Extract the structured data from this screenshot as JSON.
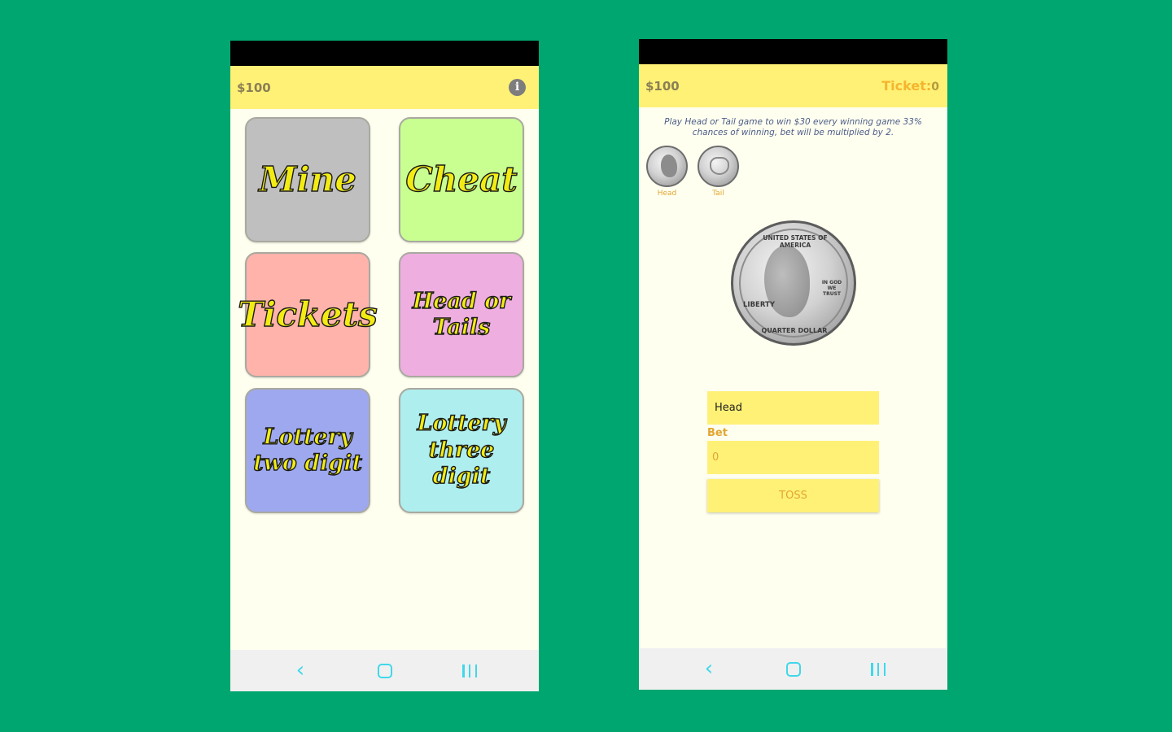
{
  "colors": {
    "background": "#00a66f",
    "appbar": "#fff176",
    "screen": "#fffff0",
    "accent": "#e1a631",
    "nav_icon": "#3fd8ea"
  },
  "menu_screen": {
    "balance": "$100",
    "info_icon": "i",
    "tiles": [
      {
        "label": "Mine",
        "color": "#bfbfbf"
      },
      {
        "label": "Cheat",
        "color": "#c8ff90"
      },
      {
        "label": "Tickets",
        "color": "#ffb3aa"
      },
      {
        "label": "Head or Tails",
        "color": "#eeaee0"
      },
      {
        "label": "Lottery two digit",
        "color": "#9ea8ee"
      },
      {
        "label": "Lottery three digit",
        "color": "#aeeeee"
      }
    ]
  },
  "game_screen": {
    "balance": "$100",
    "ticket_label": "Ticket:",
    "ticket_count": "0",
    "description": "Play Head or Tail game to win $30 every winning game 33% chances of winning, bet will be multiplied by 2.",
    "coin_options": [
      {
        "label": "Head"
      },
      {
        "label": "Tail"
      }
    ],
    "coin_text": {
      "top": "UNITED STATES OF AMERICA",
      "left": "LIBERTY",
      "right": "IN GOD WE TRUST",
      "bottom": "QUARTER DOLLAR"
    },
    "selection_value": "Head",
    "bet_label": "Bet",
    "bet_placeholder": "0",
    "toss_label": "TOSS"
  },
  "navbar": {
    "back_icon": "‹"
  }
}
